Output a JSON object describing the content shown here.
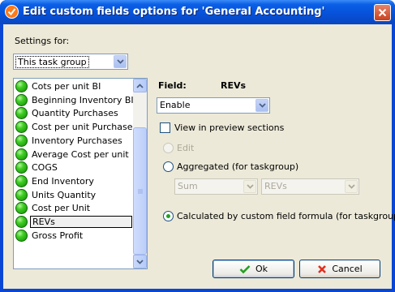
{
  "window": {
    "title": "Edit custom fields options for  'General Accounting'"
  },
  "settings_for": {
    "label": "Settings for:",
    "value": "This task group"
  },
  "fields_list": {
    "items": [
      "Cots per unit BI",
      "Beginning Inventory BI",
      "Quantity Purchases",
      "Cost per unit Purchases",
      "Inventory Purchases",
      "Average Cost per unit",
      "COGS",
      "End Inventory",
      "Units Quantity",
      "Cost per Unit",
      "REVs",
      "Gross Profit"
    ],
    "selected": "REVs"
  },
  "field": {
    "label": "Field:",
    "name": "REVs"
  },
  "enable_combo": {
    "value": "Enable"
  },
  "view_preview": {
    "label": "View in preview sections",
    "checked": false
  },
  "mode": {
    "edit_label": "Edit",
    "aggregated_label": "Aggregated (for taskgroup)",
    "aggregate_function": "Sum",
    "aggregate_field": "REVs",
    "formula_label": "Calculated by custom field formula (for taskgroup)",
    "selected": "formula"
  },
  "buttons": {
    "ok": "Ok",
    "cancel": "Cancel"
  },
  "colors": {
    "titlebar": "#0a5fe6",
    "dialog_bg": "#ece9d8",
    "status_green": "#3fcf22",
    "ok_check": "#21a121",
    "cancel_x": "#e0301e"
  }
}
